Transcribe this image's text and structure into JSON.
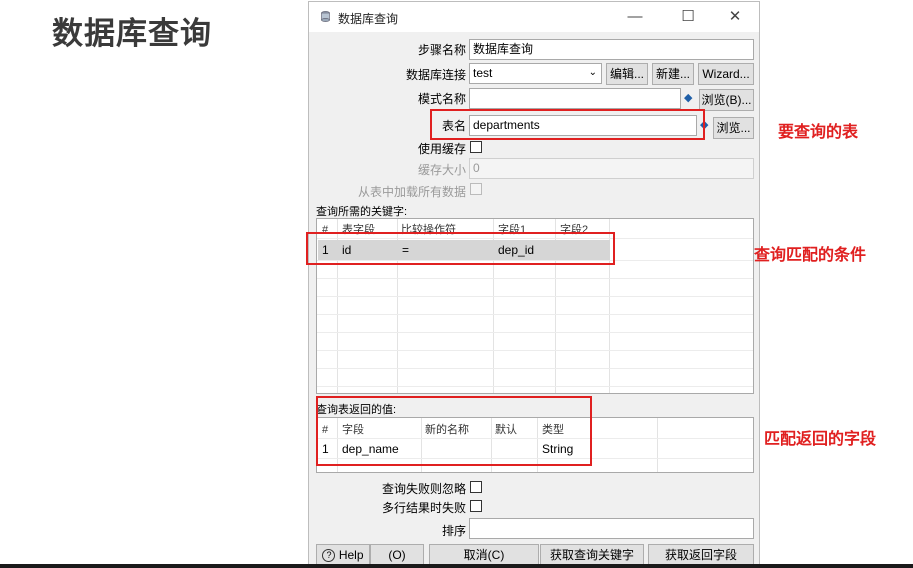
{
  "slide_title": "数据库查询",
  "dialog": {
    "title": "数据库查询",
    "step_name_label": "步骤名称",
    "step_name_value": "数据库查询",
    "conn_label": "数据库连接",
    "conn_value": "test",
    "edit_button": "编辑...",
    "new_button": "新建...",
    "wizard_button": "Wizard...",
    "schema_label": "模式名称",
    "schema_value": "",
    "browse_schema_button": "浏览(B)...",
    "table_label": "表名",
    "table_value": "departments",
    "browse_table_button": "浏览...",
    "use_cache_label": "使用缓存",
    "cache_size_label": "缓存大小",
    "cache_size_value": "0",
    "load_all_label": "从表中加载所有数据",
    "keys_section_label": "查询所需的关键字:",
    "keys_table": {
      "headers": [
        "#",
        "表字段",
        "比较操作符",
        "字段1",
        "字段2"
      ],
      "rows": [
        [
          "1",
          "id",
          "=",
          "dep_id",
          ""
        ]
      ]
    },
    "return_section_label": "查询表返回的值:",
    "return_table": {
      "headers": [
        "#",
        "字段",
        "新的名称",
        "默认",
        "类型"
      ],
      "rows": [
        [
          "1",
          "dep_name",
          "",
          "",
          "String"
        ]
      ]
    },
    "ignore_fail_label": "查询失败则忽略",
    "multi_fail_label": "多行结果时失败",
    "sort_label": "排序",
    "sort_value": "",
    "help_button": "Help",
    "ok_button": "(O)",
    "cancel_button": "取消(C)",
    "get_keys_button": "获取查询关键字",
    "get_fields_button": "获取返回字段"
  },
  "annotations": {
    "table": "要查询的表",
    "condition": "查询匹配的条件",
    "fields": "匹配返回的字段"
  },
  "colors": {
    "highlight": "#e02020",
    "dialog_bg": "#f0f0f0"
  }
}
